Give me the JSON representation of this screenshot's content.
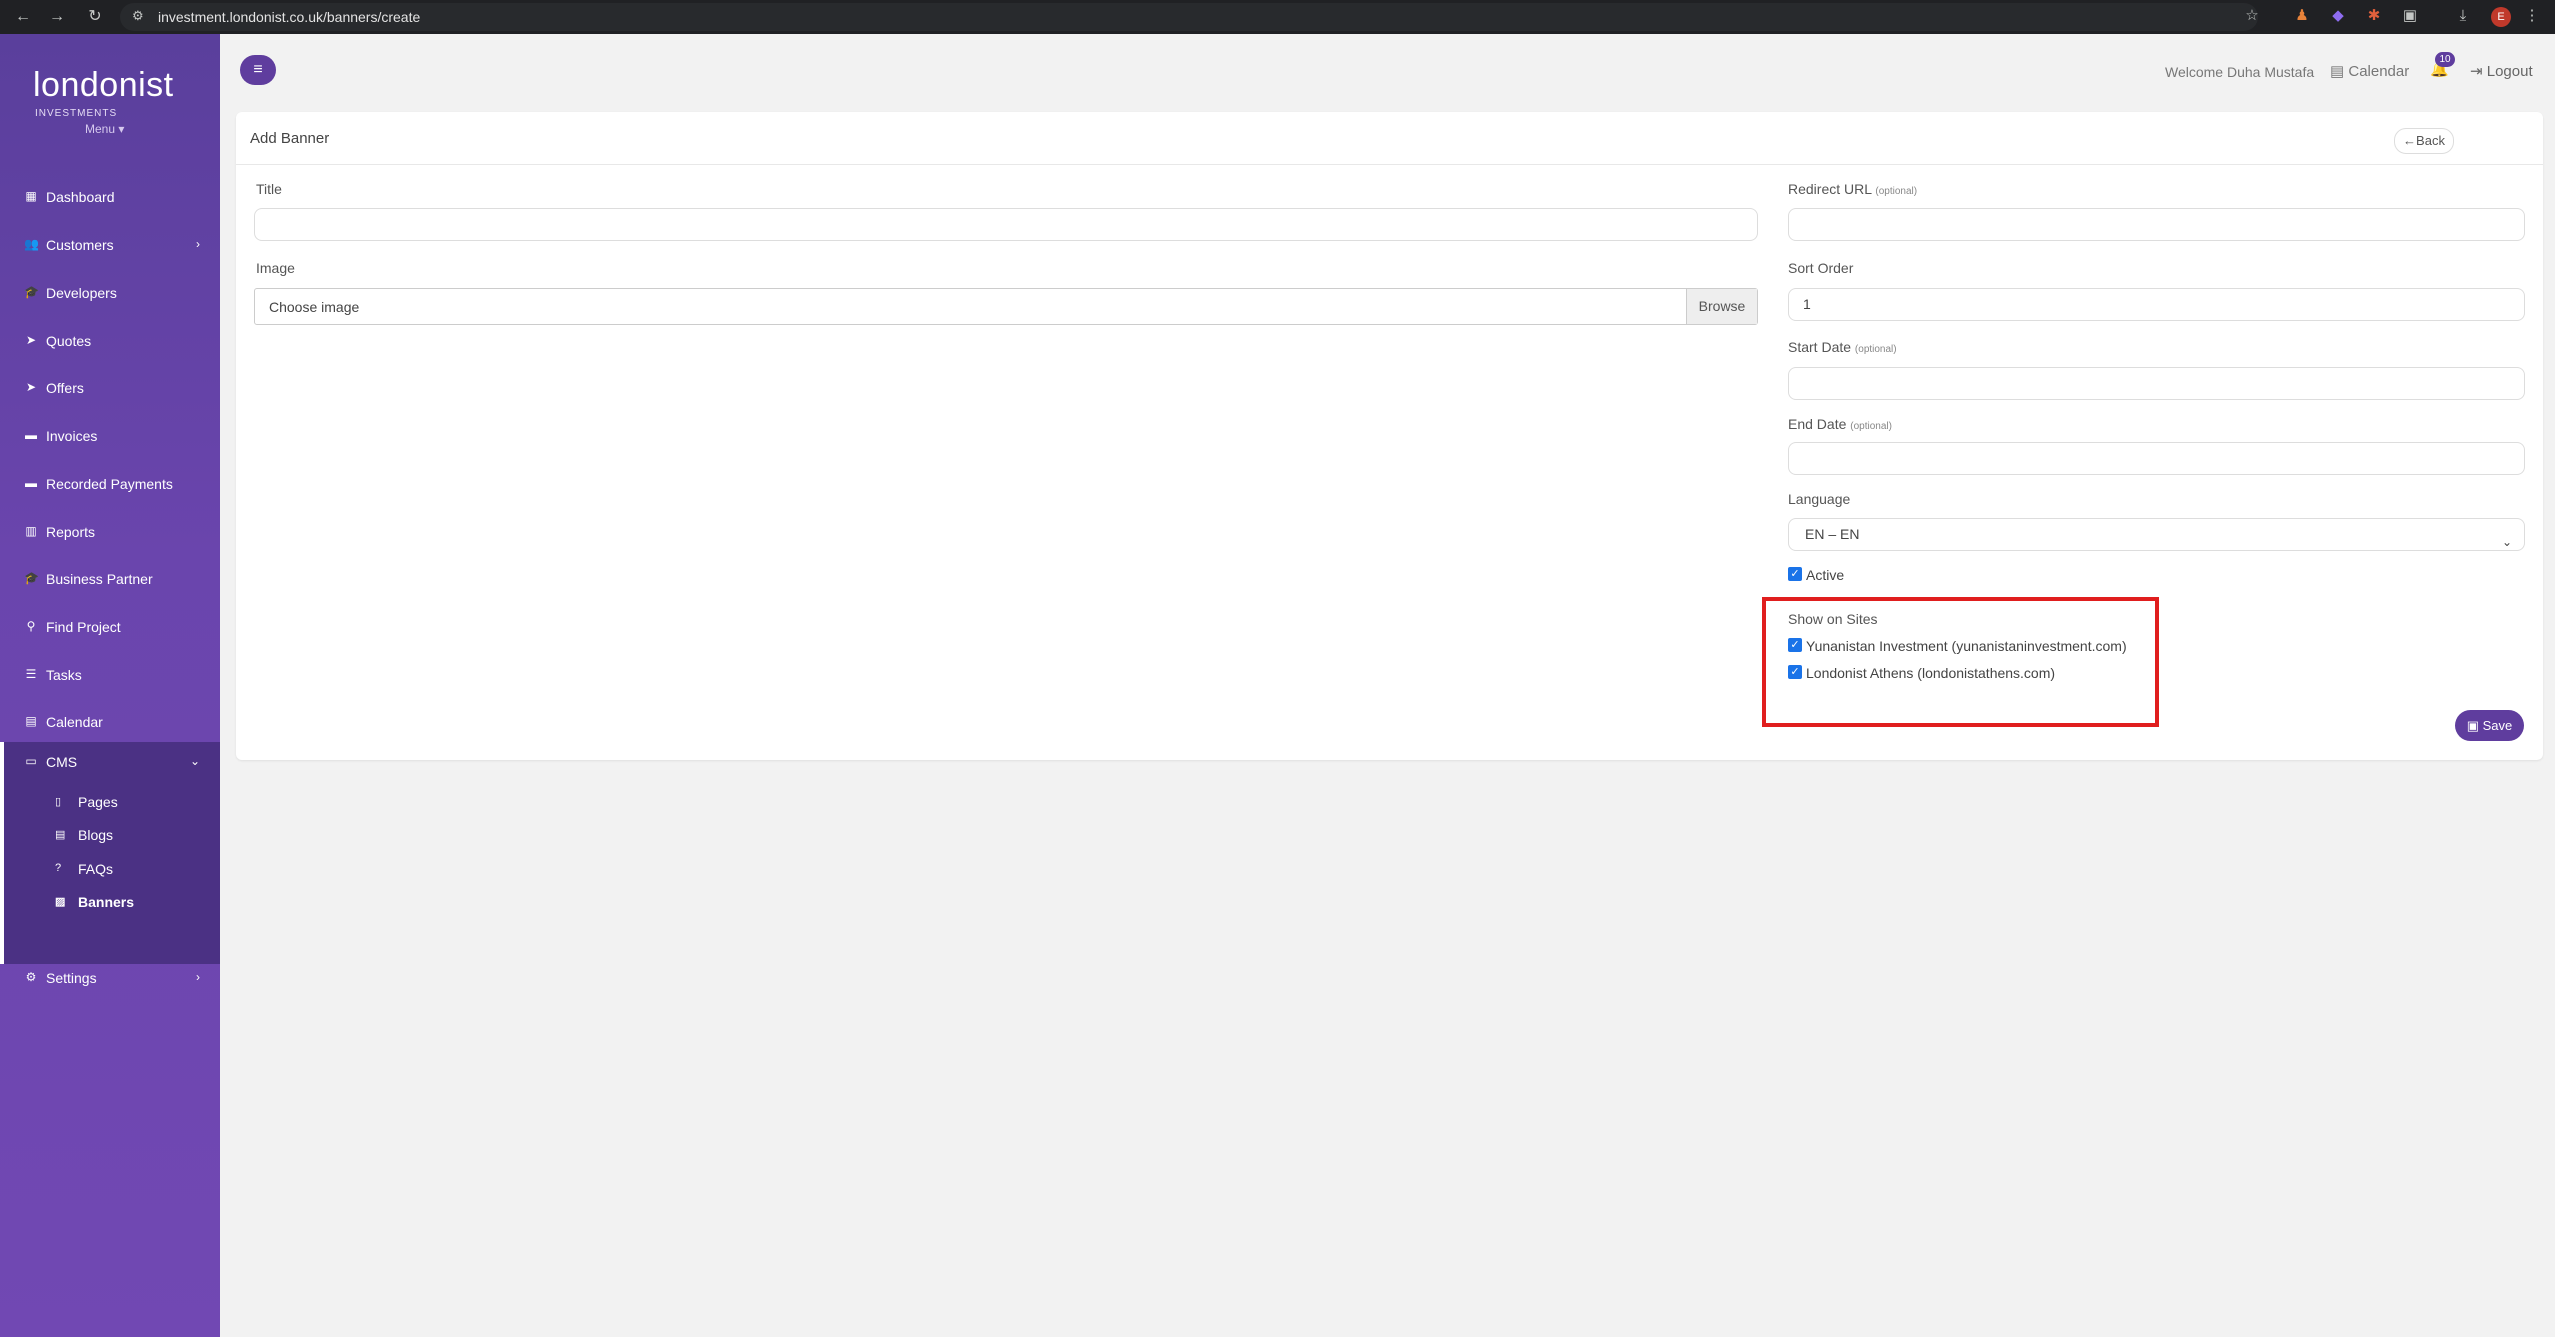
{
  "browser": {
    "url": "investment.londonist.co.uk/banners/create",
    "profile_initial": "E"
  },
  "sidebar": {
    "logo": "londonist",
    "logo_sub": "INVESTMENTS",
    "menu_label": "Menu",
    "items": [
      {
        "label": "Dashboard",
        "icon": "dashboard-icon"
      },
      {
        "label": "Customers",
        "icon": "users-icon"
      },
      {
        "label": "Developers",
        "icon": "graduation-cap-icon"
      },
      {
        "label": "Quotes",
        "icon": "rocket-icon"
      },
      {
        "label": "Offers",
        "icon": "rocket-icon"
      },
      {
        "label": "Invoices",
        "icon": "credit-card-icon"
      },
      {
        "label": "Recorded Payments",
        "icon": "credit-card-icon"
      },
      {
        "label": "Reports",
        "icon": "bar-chart-icon"
      },
      {
        "label": "Business Partner",
        "icon": "graduation-cap-icon"
      },
      {
        "label": "Find Project",
        "icon": "search-icon"
      },
      {
        "label": "Tasks",
        "icon": "list-icon"
      },
      {
        "label": "Calendar",
        "icon": "calendar-icon"
      }
    ],
    "cms": {
      "label": "CMS",
      "children": [
        "Pages",
        "Blogs",
        "FAQs",
        "Banners"
      ]
    },
    "settings_label": "Settings"
  },
  "topbar": {
    "welcome": "Welcome Duha Mustafa",
    "calendar": "Calendar",
    "notification_count": "10",
    "logout": "Logout"
  },
  "form": {
    "heading": "Add Banner",
    "back_label": "Back",
    "title_label": "Title",
    "title_value": "",
    "image_label": "Image",
    "image_placeholder": "Choose image",
    "browse_label": "Browse",
    "redirect_label": "Redirect URL",
    "optional": "(optional)",
    "redirect_value": "",
    "sort_label": "Sort Order",
    "sort_value": "1",
    "start_label": "Start Date",
    "start_value": "",
    "end_label": "End Date",
    "end_value": "",
    "language_label": "Language",
    "language_value": "EN – EN",
    "active_label": "Active",
    "active_checked": true,
    "sites_label": "Show on Sites",
    "sites": [
      {
        "label": "Yunanistan Investment (yunanistaninvestment.com)",
        "checked": true
      },
      {
        "label": "Londonist Athens (londonistathens.com)",
        "checked": true
      }
    ],
    "save_label": "Save"
  },
  "colors": {
    "brand_purple": "#5f3d9e",
    "sidebar_gradient_start": "#5a3f9c",
    "highlight": "#e01e1e",
    "checkbox": "#1a73e8"
  }
}
